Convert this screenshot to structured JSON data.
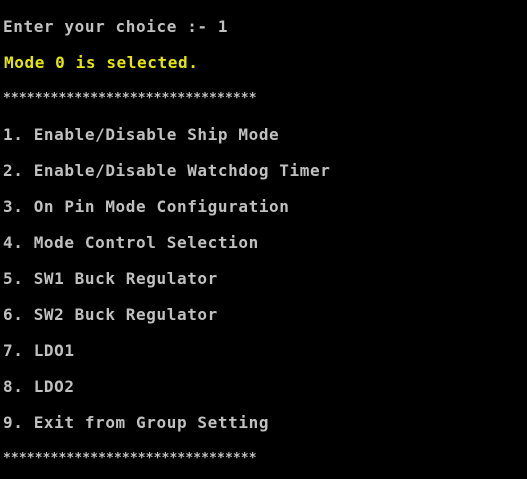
{
  "console": {
    "prompt_line": "Enter your choice :- 1",
    "status_line": "Mode 0 is selected.",
    "separator_top": "********************************",
    "menu_items": [
      "1. Enable/Disable Ship Mode",
      "2. Enable/Disable Watchdog Timer",
      "3. On Pin Mode Configuration",
      "4. Mode Control Selection",
      "5. SW1 Buck Regulator",
      "6. SW2 Buck Regulator",
      "7. LDO1",
      "8. LDO2",
      "9. Exit from Group Setting"
    ],
    "separator_bottom": "********************************"
  },
  "colors": {
    "background": "#000000",
    "text": "#c0c0c0",
    "highlight": "#e6e600"
  }
}
